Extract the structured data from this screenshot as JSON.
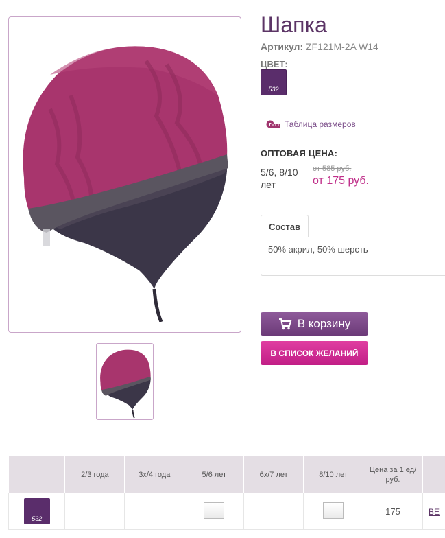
{
  "product": {
    "title": "Шапка",
    "sku_label": "Артикул:",
    "sku_value": "ZF121M-2A W14",
    "color_label": "ЦВЕТ:",
    "color_code": "532",
    "color_hex": "#5a2d6b",
    "size_chart_link": "Таблица размеров",
    "wholesale_label": "ОПТОВАЯ ЦЕНА:",
    "price_sizes": "5/6, 8/10 лет",
    "old_price": "от 585 руб.",
    "new_price": "от 175 руб."
  },
  "tabs": [
    {
      "label": "Состав",
      "content": "50% акрил, 50% шерсть"
    }
  ],
  "buttons": {
    "cart": "В корзину",
    "wishlist": "В СПИСОК ЖЕЛАНИЙ"
  },
  "table": {
    "headers": [
      "",
      "2/3 года",
      "3х/4 года",
      "5/6 лет",
      "6х/7 лет",
      "8/10 лет",
      "Цена за 1 ед/ руб.",
      ""
    ],
    "rows": [
      {
        "color_code": "532",
        "price": "175",
        "action": "ВЕ"
      }
    ]
  },
  "colors": {
    "accent": "#5c3566",
    "pink": "#c0308a",
    "hat_top": "#a8356d",
    "hat_bottom": "#3a3547"
  }
}
